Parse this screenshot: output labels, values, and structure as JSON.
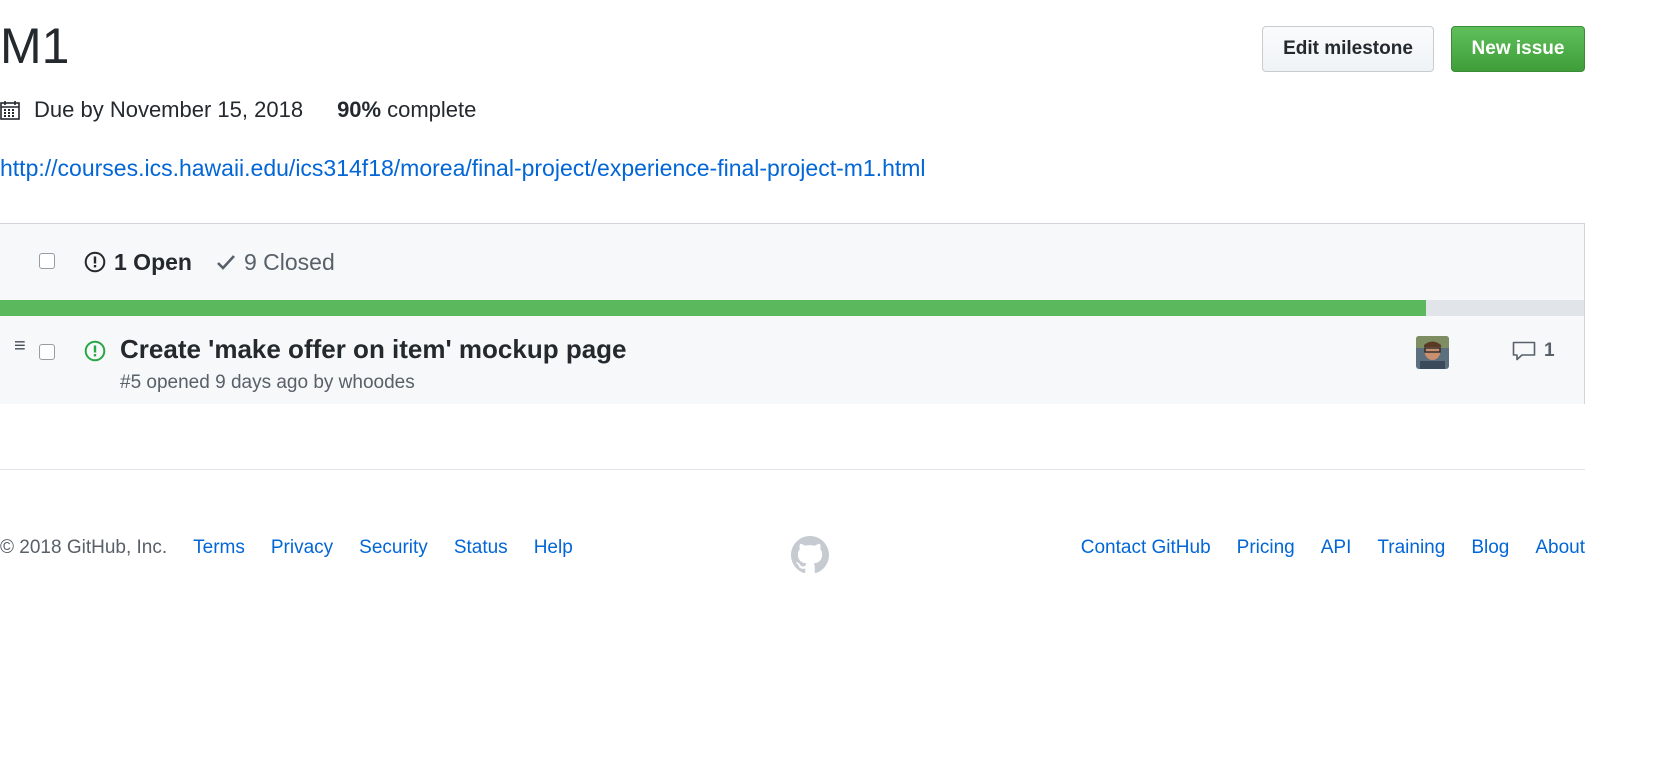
{
  "milestone": {
    "title": "M1",
    "due_text": "Due by November 15, 2018",
    "percent": "90%",
    "percent_label": "complete",
    "progress": 0.9,
    "description_link": "http://courses.ics.hawaii.edu/ics314f18/morea/final-project/experience-final-project-m1.html"
  },
  "actions": {
    "edit_label": "Edit milestone",
    "new_issue_label": "New issue"
  },
  "states": {
    "open_label": "1 Open",
    "closed_label": "9 Closed"
  },
  "issues": [
    {
      "title": "Create 'make offer on item' mockup page",
      "meta": "#5 opened 9 days ago by whoodes",
      "comments": "1",
      "state": "open"
    }
  ],
  "footer": {
    "copyright": "© 2018 GitHub, Inc.",
    "left_links": [
      "Terms",
      "Privacy",
      "Security",
      "Status",
      "Help"
    ],
    "right_links": [
      "Contact GitHub",
      "Pricing",
      "API",
      "Training",
      "Blog",
      "About"
    ]
  },
  "colors": {
    "accent": "#0366d6",
    "success": "#28a745",
    "progress": "#5cb85c"
  },
  "icons": {
    "calendar": "calendar-icon",
    "open_issue": "issue-opened-icon",
    "check": "check-icon",
    "comment": "comment-icon",
    "github": "github-mark-icon"
  }
}
